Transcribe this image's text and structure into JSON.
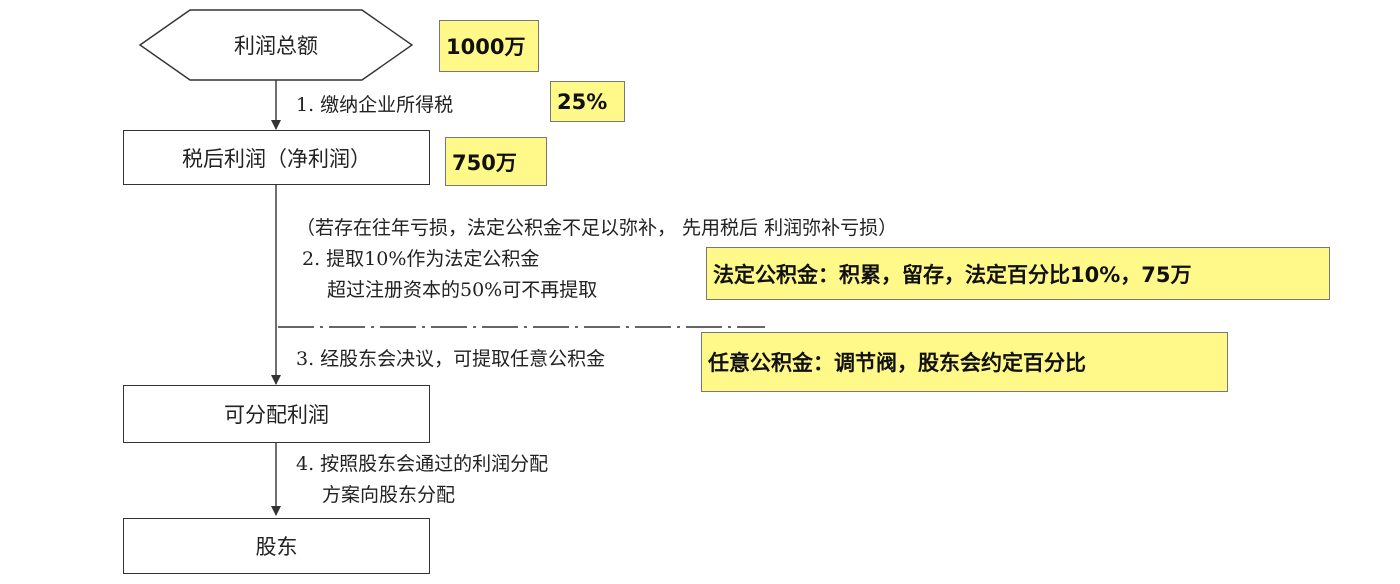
{
  "nodes": {
    "total_profit": "利润总额",
    "after_tax": "税后利润（净利润）",
    "distributable": "可分配利润",
    "shareholders": "股东"
  },
  "steps": {
    "step1": "1. 缴纳企业所得税",
    "note_loss": "（若存在往年亏损，法定公积金不足以弥补， 先用税后 利润弥补亏损）",
    "step2_line1": "2. 提取10%作为法定公积金",
    "step2_line2": "超过注册资本的50%可不再提取",
    "step3": "3. 经股东会决议，可提取任意公积金",
    "step4_line1": "4. 按照股东会通过的利润分配",
    "step4_line2": "方案向股东分配"
  },
  "callouts": {
    "total_amount": "1000万",
    "tax_rate": "25%",
    "after_tax_amount": "750万",
    "statutory_reserve": "法定公积金：积累，留存，法定百分比10%，75万",
    "discretionary_reserve": "任意公积金：调节阀，股东会约定百分比"
  },
  "colors": {
    "callout_fill": "#fff98a",
    "line": "#333333"
  }
}
